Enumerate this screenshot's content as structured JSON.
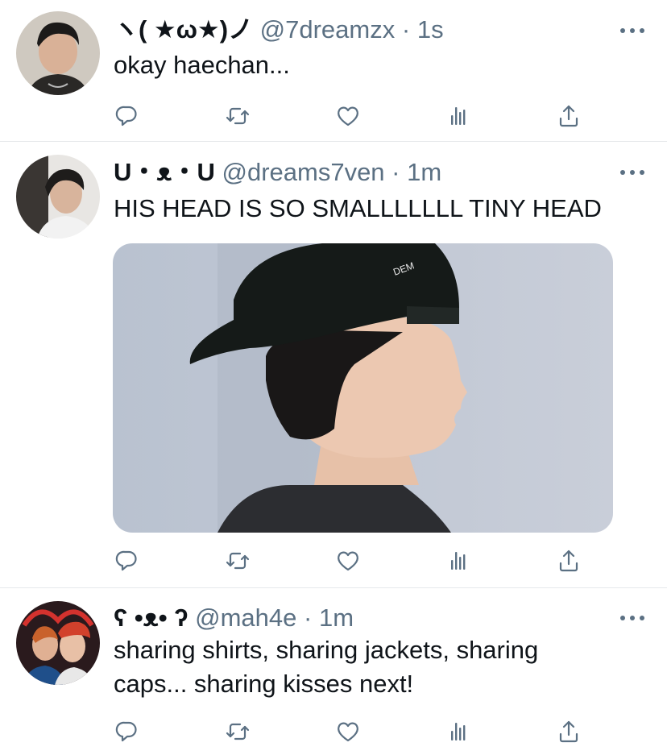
{
  "tweets": [
    {
      "display_name": "ヽ( ★ω★)ノ",
      "handle": "@7dreamzx",
      "separator": "·",
      "time": "1s",
      "text": "okay haechan..."
    },
    {
      "display_name": "U・ᴥ・U",
      "handle": "@dreams7ven",
      "separator": "·",
      "time": "1m",
      "text": "HIS HEAD IS SO SMALLLLLLL TINY HEAD",
      "has_media": true
    },
    {
      "display_name": "ʕ •ᴥ• ʔ",
      "handle": "@mah4e",
      "separator": "·",
      "time": "1m",
      "text_line1": "sharing shirts, sharing jackets, sharing",
      "text_line2": "caps... sharing kisses next!"
    }
  ],
  "action_icons": [
    "reply-icon",
    "retweet-icon",
    "like-icon",
    "analytics-icon",
    "share-icon"
  ],
  "colors": {
    "icon": "#5b7083",
    "text": "#0f1419",
    "secondary": "#5b7083",
    "divider": "#e6e9eb"
  }
}
